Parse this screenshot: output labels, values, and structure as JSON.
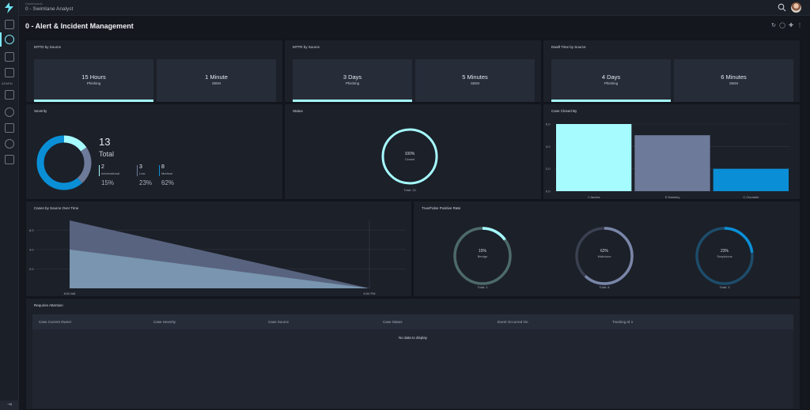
{
  "topbar": {
    "breadcrumb": "Dashboards",
    "app_title": "0 - Swimlane Analyst"
  },
  "page": {
    "title": "0 - Alert & Incident Management"
  },
  "sidebar": {
    "admin_label": "ADMIN"
  },
  "mttd": {
    "title": "MTTD by Source",
    "cards": [
      {
        "value": "15 Hours",
        "label": "Phishing"
      },
      {
        "value": "1 Minute",
        "label": "SIEM"
      }
    ]
  },
  "mttr": {
    "title": "MTTR by Source",
    "cards": [
      {
        "value": "3 Days",
        "label": "Phishing"
      },
      {
        "value": "5 Minutes",
        "label": "SIEM"
      }
    ]
  },
  "dwell": {
    "title": "Dwell Time by Source",
    "cards": [
      {
        "value": "4 Days",
        "label": "Phishing"
      },
      {
        "value": "6 Minutes",
        "label": "SIEM"
      }
    ]
  },
  "severity": {
    "title": "Severity",
    "total_value": "13",
    "total_label": "Total",
    "items": [
      {
        "count": "2",
        "label": "Informational",
        "pct": "15%",
        "color": "#a6fbff"
      },
      {
        "count": "3",
        "label": "Low",
        "pct": "23%",
        "color": "#6d7a99"
      },
      {
        "count": "8",
        "label": "Medium",
        "pct": "62%",
        "color": "#0a8fd6"
      }
    ]
  },
  "status": {
    "title": "Status",
    "pct": "100%",
    "label": "Closed",
    "total": "Total: 13"
  },
  "closed_by": {
    "title": "Case Closed By"
  },
  "cases_over_time": {
    "title": "Cases by Source Over Time"
  },
  "tfp": {
    "title": "True/False Positive Rate",
    "donuts": [
      {
        "pct": "15%",
        "label": "Benign",
        "total": "Total: 2",
        "fraction": 0.15,
        "track": "#4d6a6a",
        "color": "#a6fbff"
      },
      {
        "pct": "62%",
        "label": "Malicious",
        "total": "Total: 8",
        "fraction": 0.62,
        "track": "#3a4050",
        "color": "#7a86a8"
      },
      {
        "pct": "23%",
        "label": "Suspicious",
        "total": "Total: 3",
        "fraction": 0.23,
        "track": "#1d4c6a",
        "color": "#0a8fd6"
      }
    ]
  },
  "attention": {
    "title": "Requires Attention",
    "columns": [
      "Case Current Owner",
      "Case Severity",
      "Case Source",
      "Case Status",
      "Event Occurred On",
      "Tracking Id"
    ],
    "sort_indicator": "∨",
    "empty_text": "No data to display"
  },
  "chart_data": [
    {
      "type": "pie",
      "title": "Severity",
      "categories": [
        "Informational",
        "Low",
        "Medium"
      ],
      "values": [
        2,
        3,
        8
      ]
    },
    {
      "type": "bar",
      "title": "Case Closed By",
      "categories": [
        "J.Jacobs",
        "S.Swimley",
        "C.Chumble"
      ],
      "values": [
        6,
        5,
        2
      ],
      "ylim": [
        0,
        6
      ],
      "yticks": [
        "0.0",
        "2.0",
        "4.0",
        "6.0"
      ],
      "colors": [
        "#a6fbff",
        "#6d7a99",
        "#0a8fd6"
      ]
    },
    {
      "type": "area",
      "title": "Cases by Source Over Time",
      "x": [
        "8:00 AM",
        "6:00 PM"
      ],
      "yticks": [
        "2.0",
        "4.0",
        "6.0"
      ],
      "ylim": [
        0,
        7
      ],
      "series": [
        {
          "values": [
            7,
            0
          ],
          "color": "#5f6a88"
        },
        {
          "values": [
            4,
            0
          ],
          "color": "#7d9ab5"
        }
      ]
    }
  ]
}
